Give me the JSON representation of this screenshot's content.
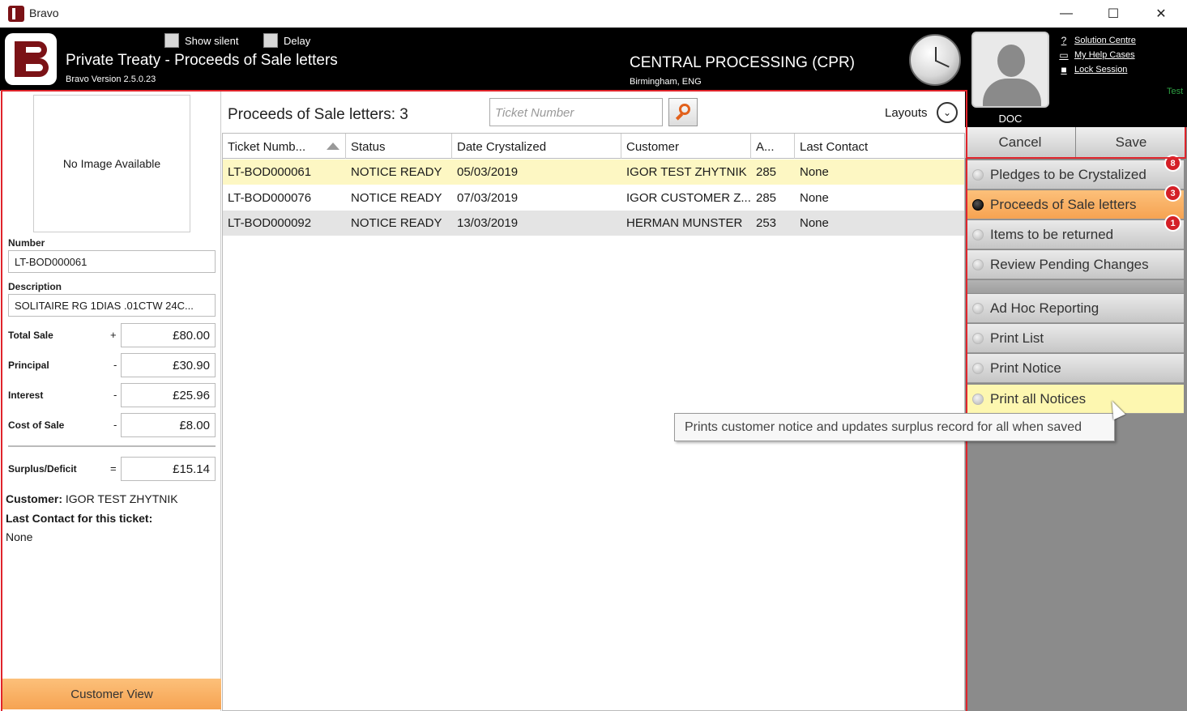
{
  "window": {
    "title": "Bravo",
    "minimize": "—",
    "maximize": "☐",
    "close": "✕"
  },
  "header": {
    "show_silent": "Show silent",
    "delay": "Delay",
    "title": "Private Treaty - Proceeds of Sale letters",
    "version": "Bravo Version 2.5.0.23",
    "site": "CENTRAL PROCESSING (CPR)",
    "location": "Birmingham, ENG",
    "user": "DOC",
    "links": [
      "Solution Centre",
      "My Help Cases",
      "Lock Session"
    ],
    "test_tag": "Test"
  },
  "left": {
    "no_image": "No Image Available",
    "number_label": "Number",
    "number_value": "LT-BOD000061",
    "description_label": "Description",
    "description_value": "SOLITAIRE RG 1DIAS .01CTW 24C...",
    "money": [
      {
        "label": "Total Sale",
        "op": "+",
        "value": "£80.00"
      },
      {
        "label": "Principal",
        "op": "-",
        "value": "£30.90"
      },
      {
        "label": "Interest",
        "op": "-",
        "value": "£25.96"
      },
      {
        "label": "Cost of Sale",
        "op": "-",
        "value": "£8.00"
      }
    ],
    "surplus": {
      "label": "Surplus/Deficit",
      "op": "=",
      "value": "£15.14"
    },
    "customer_label": "Customer:",
    "customer_value": "IGOR TEST ZHYTNIK",
    "last_contact_label": "Last Contact for this ticket:",
    "last_contact_value": "None",
    "customer_view": "Customer View"
  },
  "center": {
    "list_title": "Proceeds of Sale letters: 3",
    "search_placeholder": "Ticket Number",
    "layouts": "Layouts",
    "columns": [
      "Ticket Numb...",
      "Status",
      "Date Crystalized",
      "Customer",
      "A...",
      "Last Contact"
    ],
    "rows": [
      [
        "LT-BOD000061",
        "NOTICE READY",
        "05/03/2019",
        "IGOR TEST ZHYTNIK",
        "285",
        "None"
      ],
      [
        "LT-BOD000076",
        "NOTICE READY",
        "07/03/2019",
        "IGOR CUSTOMER Z...",
        "285",
        "None"
      ],
      [
        "LT-BOD000092",
        "NOTICE READY",
        "13/03/2019",
        "HERMAN MUNSTER",
        "253",
        "None"
      ]
    ],
    "row_colors": [
      "#fdf7c3",
      "#ffffff",
      "#e4e4e4"
    ]
  },
  "right": {
    "cancel": "Cancel",
    "save": "Save",
    "queue": [
      {
        "label": "Pledges to be Crystalized",
        "badge": "8"
      },
      {
        "label": "Proceeds of Sale letters",
        "badge": "3"
      },
      {
        "label": "Items to be returned",
        "badge": "1"
      },
      {
        "label": "Review Pending Changes",
        "badge": ""
      }
    ],
    "actions": [
      "Ad Hoc Reporting",
      "Print List",
      "Print Notice",
      "Print all Notices"
    ]
  },
  "tooltip": "Prints customer notice and updates surplus record for all when saved",
  "colors": {
    "accent_red": "#e0242b",
    "brand_maroon": "#7b1216",
    "active_orange": "#f6a352",
    "hover_yellow": "#fdf7b0"
  }
}
